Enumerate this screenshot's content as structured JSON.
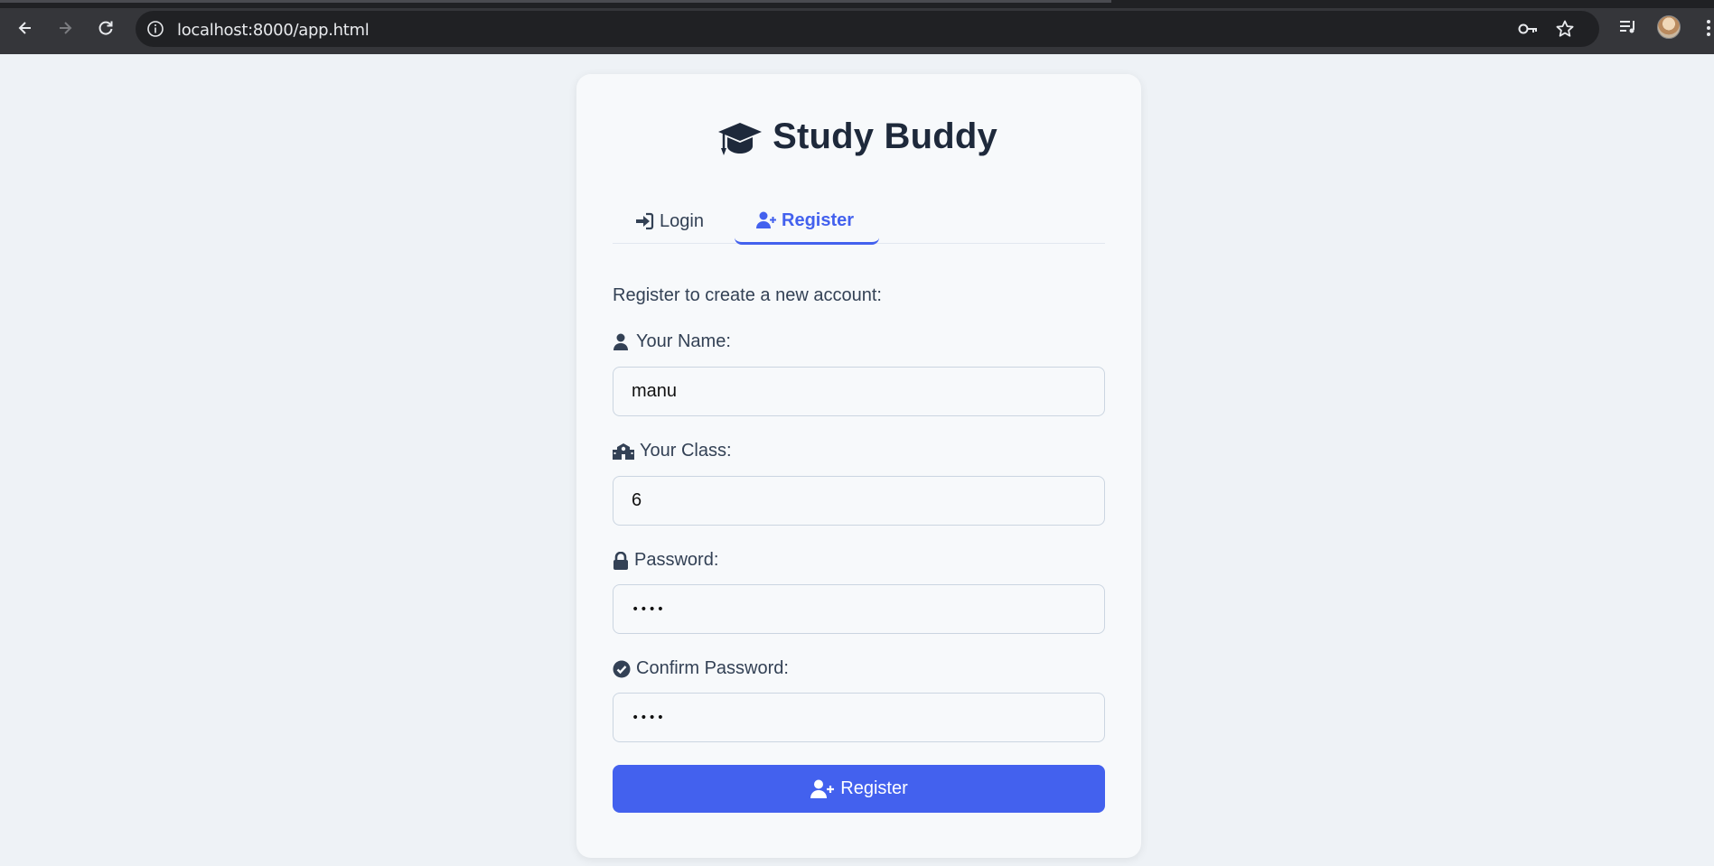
{
  "browser": {
    "url": "localhost:8000/app.html"
  },
  "app": {
    "title": "Study Buddy"
  },
  "tabs": {
    "login_label": "Login",
    "register_label": "Register",
    "active": "register"
  },
  "form": {
    "intro": "Register to create a new account:",
    "name_label": "Your Name:",
    "name_value": "manu",
    "class_label": "Your Class:",
    "class_value": "6",
    "password_label": "Password:",
    "password_value": "••••",
    "confirm_label": "Confirm Password:",
    "confirm_value": "••••",
    "submit_label": "Register"
  },
  "colors": {
    "accent": "#4361ee",
    "text_dark": "#1e293b",
    "text_body": "#334155",
    "page_bg": "#eef2f6",
    "card_bg": "#f7f9fb",
    "chrome_bg": "#35363a"
  },
  "icons": {
    "title": "graduation-cap-icon",
    "login_tab": "sign-in-icon",
    "register_tab": "user-plus-icon",
    "name": "user-icon",
    "class": "school-icon",
    "password": "lock-icon",
    "confirm": "check-circle-icon",
    "submit": "user-plus-icon"
  }
}
